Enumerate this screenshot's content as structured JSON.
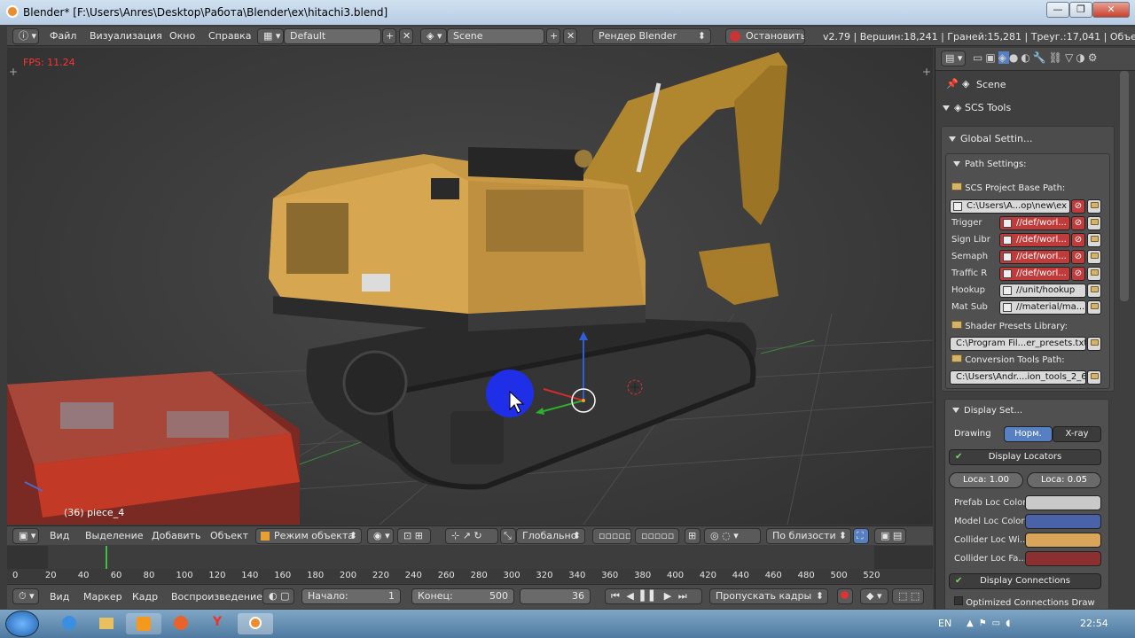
{
  "window": {
    "title": "Blender* [F:\\Users\\Anres\\Desktop\\Работа\\Blender\\ex\\hitachi3.blend]",
    "minimize": "—",
    "maximize": "❐",
    "close": "✕"
  },
  "info_header": {
    "menus": [
      "Файл",
      "Визуализация",
      "Окно",
      "Справка"
    ],
    "layout": "Default",
    "scene": "Scene",
    "engine": "Рендер Blender",
    "stop_label": "Остановить",
    "stats": "v2.79 | Вершин:18,241 | Граней:15,281 | Треуг.:17,041 | Объектов:"
  },
  "viewport": {
    "fps": "FPS: 11.24",
    "object_label": "(36) piece_4"
  },
  "header_3d": {
    "menus": [
      "Вид",
      "Выделение",
      "Добавить",
      "Объект"
    ],
    "mode": "Режим объекта",
    "orientation": "Глобально",
    "snap": "По близости"
  },
  "timeline": {
    "ticks": [
      "0",
      "20",
      "40",
      "60",
      "80",
      "100",
      "120",
      "140",
      "160",
      "180",
      "200",
      "220",
      "240",
      "260",
      "280",
      "300",
      "320",
      "340",
      "360",
      "380",
      "400",
      "420",
      "440",
      "460",
      "480",
      "500",
      "520"
    ],
    "current_frame_marker": "36",
    "menus": [
      "Вид",
      "Маркер",
      "Кадр",
      "Воспроизведение"
    ],
    "start_label": "Начало:",
    "start_value": "1",
    "end_label": "Конец:",
    "end_value": "500",
    "current": "36",
    "sync": "Пропускать кадры"
  },
  "properties": {
    "breadcrumb": "Scene",
    "section": "SCS Tools",
    "global_settings": "Global Settin...",
    "path_settings": "Path Settings:",
    "project_base_path_label": "SCS Project Base Path:",
    "project_base_path": "C:\\Users\\A...op\\new\\ex",
    "paths": [
      {
        "label": "Trigger",
        "value": "//def/worl...",
        "invalid": true
      },
      {
        "label": "Sign Libr",
        "value": "//def/worl...",
        "invalid": true
      },
      {
        "label": "Semaph",
        "value": "//def/worl...",
        "invalid": true
      },
      {
        "label": "Traffic R",
        "value": "//def/worl...",
        "invalid": true
      },
      {
        "label": "Hookup",
        "value": "//unit/hookup",
        "invalid": false
      },
      {
        "label": "Mat Sub",
        "value": "//material/ma...",
        "invalid": false
      }
    ],
    "shader_presets_label": "Shader Presets Library:",
    "shader_presets_path": "C:\\Program Fil...er_presets.txt",
    "conversion_tools_label": "Conversion Tools Path:",
    "conversion_tools_path": "C:\\Users\\Andr....ion_tools_2_6\\",
    "display_settings": "Display Set...",
    "drawing_label": "Drawing",
    "drawing_normal": "Норм.",
    "drawing_xray": "X-ray",
    "display_locators": "Display Locators",
    "loca_1": "Loca: 1.00",
    "loca_2": "Loca: 0.05",
    "colors": [
      {
        "label": "Prefab Loc Color:",
        "color": "#c9c9c9"
      },
      {
        "label": "Model Loc Color:",
        "color": "#4a63a8"
      },
      {
        "label": "Collider Loc Wi...",
        "color": "#d8a55a"
      },
      {
        "label": "Collider Loc Fa...",
        "color": "#8a3030"
      }
    ],
    "display_connections": "Display Connections",
    "optimized": "Optimized Connections Draw"
  },
  "taskbar": {
    "lang": "EN",
    "time": "22:54"
  }
}
